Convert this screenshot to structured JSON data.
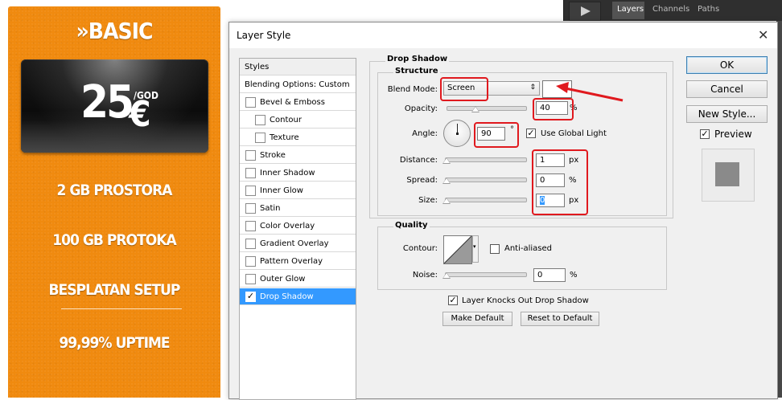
{
  "pricing": {
    "plan": "»BASIC",
    "price": "25",
    "currency": "€",
    "period": "/GOD",
    "features": [
      "2 GB PROSTORA",
      "100 GB PROTOKA",
      "BESPLATAN SETUP",
      "99,99% UPTIME"
    ]
  },
  "panel": {
    "tabs": [
      "Layers",
      "Channels",
      "Paths"
    ]
  },
  "dialog": {
    "title": "Layer Style",
    "styles_header": "Styles",
    "blending_options": "Blending Options: Custom",
    "effects": [
      {
        "label": "Bevel & Emboss",
        "checked": false
      },
      {
        "label": "Contour",
        "checked": false
      },
      {
        "label": "Texture",
        "checked": false
      },
      {
        "label": "Stroke",
        "checked": false
      },
      {
        "label": "Inner Shadow",
        "checked": false
      },
      {
        "label": "Inner Glow",
        "checked": false
      },
      {
        "label": "Satin",
        "checked": false
      },
      {
        "label": "Color Overlay",
        "checked": false
      },
      {
        "label": "Gradient Overlay",
        "checked": false
      },
      {
        "label": "Pattern Overlay",
        "checked": false
      },
      {
        "label": "Outer Glow",
        "checked": false
      },
      {
        "label": "Drop Shadow",
        "checked": true
      }
    ],
    "section_title": "Drop Shadow",
    "structure": {
      "title": "Structure",
      "blend_mode_label": "Blend Mode:",
      "blend_mode": "Screen",
      "shadow_color": "#ffffff",
      "opacity_label": "Opacity:",
      "opacity": "40",
      "opacity_unit": "%",
      "angle_label": "Angle:",
      "angle": "90",
      "angle_unit": "°",
      "use_global_light": "Use Global Light",
      "use_global_light_checked": true,
      "distance_label": "Distance:",
      "distance": "1",
      "distance_unit": "px",
      "spread_label": "Spread:",
      "spread": "0",
      "spread_unit": "%",
      "size_label": "Size:",
      "size": "0",
      "size_unit": "px"
    },
    "quality": {
      "title": "Quality",
      "contour_label": "Contour:",
      "anti_aliased": "Anti-aliased",
      "noise_label": "Noise:",
      "noise": "0",
      "noise_unit": "%"
    },
    "knock_out": "Layer Knocks Out Drop Shadow",
    "make_default": "Make Default",
    "reset_default": "Reset to Default",
    "ok": "OK",
    "cancel": "Cancel",
    "new_style": "New Style...",
    "preview": "Preview",
    "preview_checked": true
  },
  "colors": {
    "card_orange": "#f08a0f",
    "annotation_red": "#e0191e",
    "selection_blue": "#3399ff"
  }
}
